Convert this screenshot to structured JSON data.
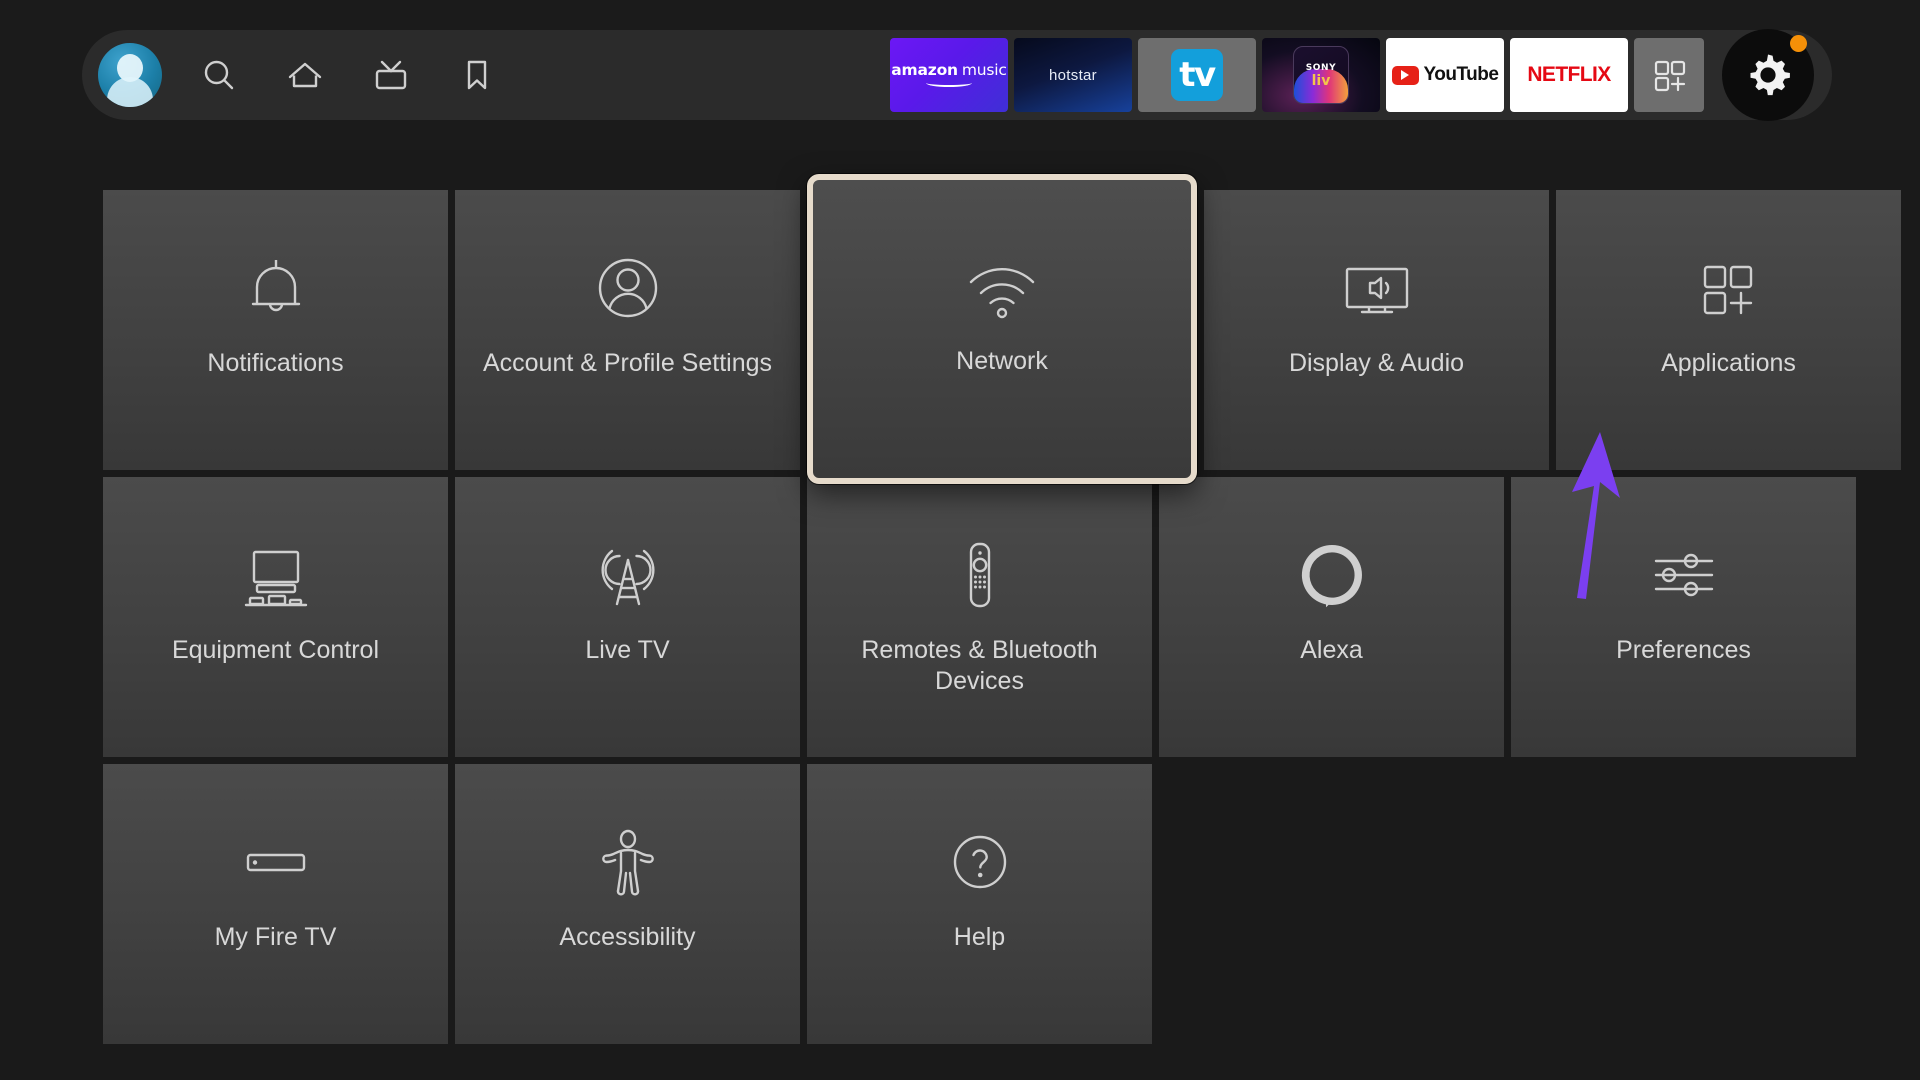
{
  "topbar": {
    "avatar": {
      "name": "profile-avatar"
    },
    "nav_items": [
      {
        "name": "search-icon",
        "label": "Search"
      },
      {
        "name": "home-icon",
        "label": "Home"
      },
      {
        "name": "live-tv-icon",
        "label": "Live"
      },
      {
        "name": "bookmark-icon",
        "label": "Watchlist"
      }
    ],
    "apps": [
      {
        "name": "app-amazon-music",
        "label": "amazon music",
        "word1": "amazon",
        "word2": "music"
      },
      {
        "name": "app-hotstar",
        "label": "hotstar"
      },
      {
        "name": "app-apple-tv",
        "label": "tv"
      },
      {
        "name": "app-sony-liv",
        "label": "SONY liv",
        "brand": "SONY",
        "sub": "liv"
      },
      {
        "name": "app-youtube",
        "label": "YouTube"
      },
      {
        "name": "app-netflix",
        "label": "NETFLIX"
      }
    ],
    "app_grid_button": {
      "name": "app-library-button",
      "label": "Apps"
    },
    "settings_button": {
      "name": "settings-gear-button",
      "label": "Settings",
      "badge": true
    }
  },
  "settings_grid": {
    "rows": [
      [
        {
          "name": "tile-notifications",
          "label": "Notifications",
          "icon": "bell-icon",
          "focused": false
        },
        {
          "name": "tile-account-profile-settings",
          "label": "Account & Profile Settings",
          "icon": "person-circle-icon",
          "focused": false
        },
        {
          "name": "tile-network",
          "label": "Network",
          "icon": "wifi-icon",
          "focused": true
        },
        {
          "name": "tile-display-audio",
          "label": "Display & Audio",
          "icon": "tv-speaker-icon",
          "focused": false
        },
        {
          "name": "tile-applications",
          "label": "Applications",
          "icon": "app-squares-plus-icon",
          "focused": false
        }
      ],
      [
        {
          "name": "tile-equipment-control",
          "label": "Equipment Control",
          "icon": "equipment-icon",
          "focused": false
        },
        {
          "name": "tile-live-tv",
          "label": "Live TV",
          "icon": "antenna-tower-icon",
          "focused": false
        },
        {
          "name": "tile-remotes-bluetooth-devices",
          "label": "Remotes & Bluetooth Devices",
          "icon": "remote-control-icon",
          "focused": false
        },
        {
          "name": "tile-alexa",
          "label": "Alexa",
          "icon": "alexa-ring-icon",
          "focused": false
        },
        {
          "name": "tile-preferences",
          "label": "Preferences",
          "icon": "sliders-icon",
          "focused": false
        }
      ],
      [
        {
          "name": "tile-my-fire-tv",
          "label": "My Fire TV",
          "icon": "fire-tv-stick-icon",
          "focused": false
        },
        {
          "name": "tile-accessibility",
          "label": "Accessibility",
          "icon": "accessibility-person-icon",
          "focused": false
        },
        {
          "name": "tile-help",
          "label": "Help",
          "icon": "question-circle-icon",
          "focused": false
        }
      ]
    ]
  },
  "annotation": {
    "arrow": {
      "name": "annotation-arrow",
      "color": "#7b3ff0",
      "points_to": "tile-applications"
    }
  },
  "colors": {
    "page_background": "#1a1a1a",
    "topbar_background": "#2b2b2b",
    "tile_background": "#454545",
    "tile_label": "#d8d8d8",
    "focus_border": "#e6dbcb",
    "badge_orange": "#f59008",
    "netflix_red": "#e50914",
    "youtube_red": "#e62117",
    "arrow_purple": "#7b3ff0"
  }
}
